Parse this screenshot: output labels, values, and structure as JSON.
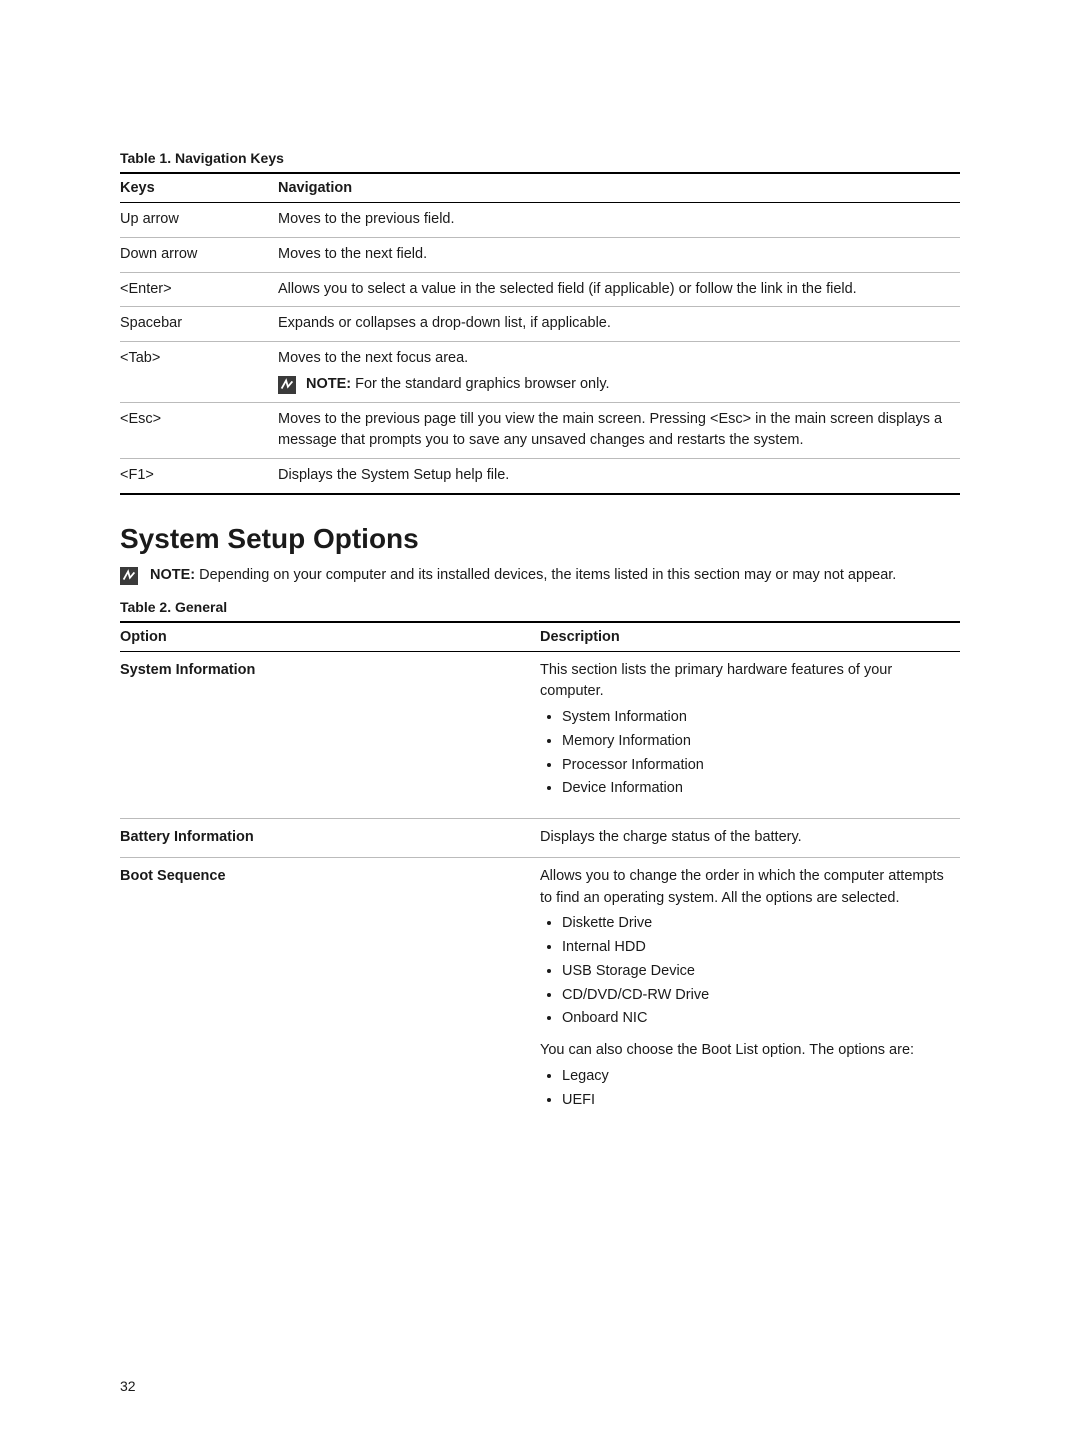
{
  "table1": {
    "caption": "Table 1. Navigation Keys",
    "header": {
      "keys": "Keys",
      "nav": "Navigation"
    },
    "rows": [
      {
        "key": "Up arrow",
        "nav": "Moves to the previous field."
      },
      {
        "key": "Down arrow",
        "nav": "Moves to the next field."
      },
      {
        "key": "<Enter>",
        "nav": "Allows you to select a value in the selected field (if applicable) or follow the link in the field."
      },
      {
        "key": "Spacebar",
        "nav": "Expands or collapses a drop-down list, if applicable."
      },
      {
        "key": "<Tab>",
        "nav": "Moves to the next focus area.",
        "note_label": "NOTE:",
        "note_text": " For the standard graphics browser only."
      },
      {
        "key": "<Esc>",
        "nav": "Moves to the previous page till you view the main screen. Pressing <Esc> in the main screen displays a message that prompts you to save any unsaved changes and restarts the system."
      },
      {
        "key": "<F1>",
        "nav": "Displays the System Setup help file."
      }
    ]
  },
  "heading": "System Setup Options",
  "section_note": {
    "label": "NOTE:",
    "text": " Depending on your computer and its installed devices, the items listed in this section may or may not appear."
  },
  "table2": {
    "caption": "Table 2. General",
    "header": {
      "option": "Option",
      "desc": "Description"
    },
    "rows": {
      "sysinfo": {
        "option": "System Information",
        "desc": "This section lists the primary hardware features of your computer.",
        "bullets": [
          "System Information",
          "Memory Information",
          "Processor Information",
          "Device Information"
        ]
      },
      "battery": {
        "option": "Battery Information",
        "desc": "Displays the charge status of the battery."
      },
      "boot": {
        "option": "Boot Sequence",
        "desc": "Allows you to change the order in which the computer attempts to find an operating system. All the options are selected.",
        "bullets": [
          "Diskette Drive",
          "Internal HDD",
          "USB Storage Device",
          "CD/DVD/CD-RW Drive",
          "Onboard NIC"
        ],
        "desc2": "You can also choose the Boot List option. The options are:",
        "bullets2": [
          "Legacy",
          "UEFI"
        ]
      }
    }
  },
  "page_number": "32"
}
